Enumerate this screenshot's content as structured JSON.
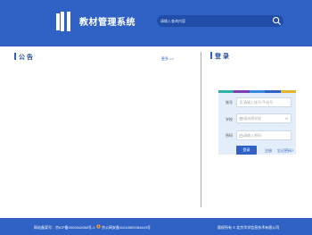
{
  "header": {
    "app_title": "教材管理系统",
    "search_placeholder": "请输入查询内容"
  },
  "notice": {
    "title": "公 告",
    "more_label": "更多 >>"
  },
  "login": {
    "title": "登 录",
    "stripe_colors": [
      "#2bb3a3",
      "#7b3fb0",
      "#3a8be0",
      "#2f62c4",
      "#e8b52a"
    ],
    "account_label": "账号",
    "account_placeholder": "请输入账号/手机号",
    "school_label": "学校",
    "school_placeholder": "请选择学校",
    "password_label": "密码",
    "password_placeholder": "请输入密码",
    "submit_label": "登录",
    "register_label": "注册",
    "forgot_label": "忘记密码?"
  },
  "footer": {
    "icp": "网站备案号：京ICP备2020042080号-1",
    "police": "京公网安备11010502054443号",
    "copyright": "版权所有 © 北京华学信息技术有限公司"
  },
  "colors": {
    "primary": "#2f62c4",
    "panel": "#e3eefa"
  }
}
